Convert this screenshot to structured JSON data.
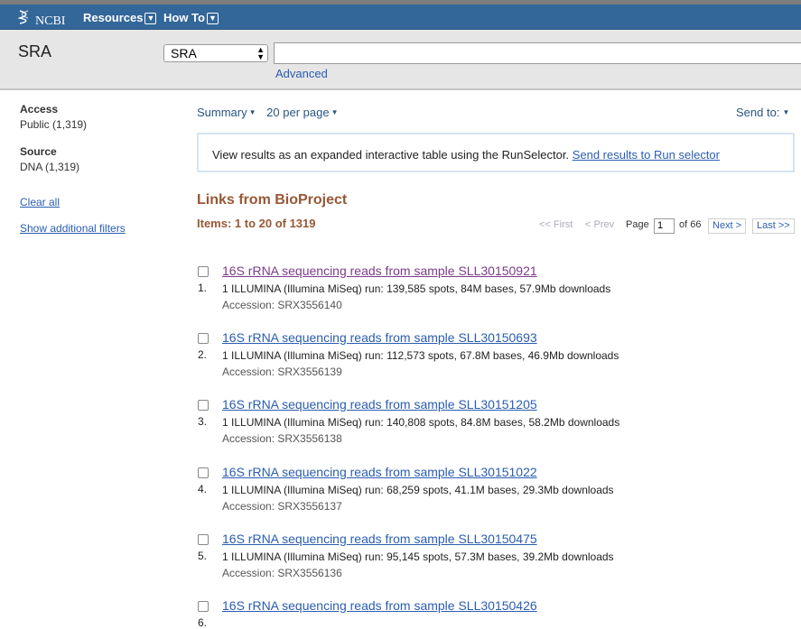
{
  "header": {
    "brand": "NCBI",
    "menus": [
      {
        "label": "Resources"
      },
      {
        "label": "How To"
      }
    ]
  },
  "search": {
    "db_title": "SRA",
    "db_selected": "SRA",
    "query": "",
    "advanced_label": "Advanced"
  },
  "sidebar": {
    "facets": [
      {
        "heading": "Access",
        "item": "Public (1,319)"
      },
      {
        "heading": "Source",
        "item": "DNA (1,319)"
      }
    ],
    "clear_all": "Clear all",
    "show_filters": "Show additional filters"
  },
  "toolbar": {
    "summary": "Summary",
    "per_page": "20 per page",
    "send_to": "Send to:"
  },
  "runselector": {
    "text": "View results as an expanded interactive table using the RunSelector.",
    "link": "Send results to Run selector"
  },
  "results_header": {
    "title": "Links from BioProject",
    "items": "Items: 1 to 20 of 1319"
  },
  "pager": {
    "first": "<< First",
    "prev": "< Prev",
    "page_label": "Page",
    "page_value": "1",
    "of": "of 66",
    "next": "Next >",
    "last": "Last >>"
  },
  "results": [
    {
      "num": "1.",
      "title": "16S rRNA sequencing reads from sample SLL30150921",
      "desc": "1 ILLUMINA (Illumina MiSeq) run: 139,585 spots, 84M bases, 57.9Mb downloads",
      "accession": "Accession: SRX3556140",
      "visited": true
    },
    {
      "num": "2.",
      "title": "16S rRNA sequencing reads from sample SLL30150693",
      "desc": "1 ILLUMINA (Illumina MiSeq) run: 112,573 spots, 67.8M bases, 46.9Mb downloads",
      "accession": "Accession: SRX3556139",
      "visited": false
    },
    {
      "num": "3.",
      "title": "16S rRNA sequencing reads from sample SLL30151205",
      "desc": "1 ILLUMINA (Illumina MiSeq) run: 140,808 spots, 84.8M bases, 58.2Mb downloads",
      "accession": "Accession: SRX3556138",
      "visited": false
    },
    {
      "num": "4.",
      "title": "16S rRNA sequencing reads from sample SLL30151022",
      "desc": "1 ILLUMINA (Illumina MiSeq) run: 68,259 spots, 41.1M bases, 29.3Mb downloads",
      "accession": "Accession: SRX3556137",
      "visited": false
    },
    {
      "num": "5.",
      "title": "16S rRNA sequencing reads from sample SLL30150475",
      "desc": "1 ILLUMINA (Illumina MiSeq) run: 95,145 spots, 57.3M bases, 39.2Mb downloads",
      "accession": "Accession: SRX3556136",
      "visited": false
    },
    {
      "num": "6.",
      "title": "16S rRNA sequencing reads from sample SLL30150426",
      "desc": "",
      "accession": "",
      "visited": false
    }
  ],
  "colors": {
    "header_bg": "#336699",
    "link": "#2a5db0",
    "visited_link": "#7b3b8a",
    "section_title": "#985735"
  }
}
